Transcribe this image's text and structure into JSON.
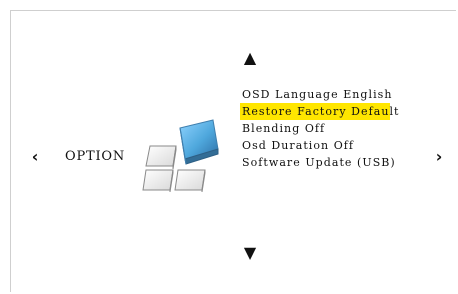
{
  "header": {
    "up_arrow": "▲",
    "down_arrow": "▼",
    "left_arrow": "‹",
    "right_arrow": "›"
  },
  "main": {
    "section_title": "OPTION",
    "menu_items": [
      "OSD Language English",
      "Restore Factory Default",
      "Blending Off",
      "Osd Duration Off",
      "Software Update (USB)"
    ],
    "selected_item": "Restore Factory Default"
  },
  "colors": {
    "selection_highlight": "#ffe600",
    "icon_blue": "#4ea7dc",
    "icon_gray": "#d9d9d9",
    "text": "#111111",
    "background": "#ffffff"
  },
  "icons": {
    "option_icon": "tiles-icon",
    "up_arrow_icon": "triangle-up-icon",
    "down_arrow_icon": "triangle-down-icon",
    "left_arrow_icon": "chevron-left-icon",
    "right_arrow_icon": "chevron-right-icon"
  }
}
